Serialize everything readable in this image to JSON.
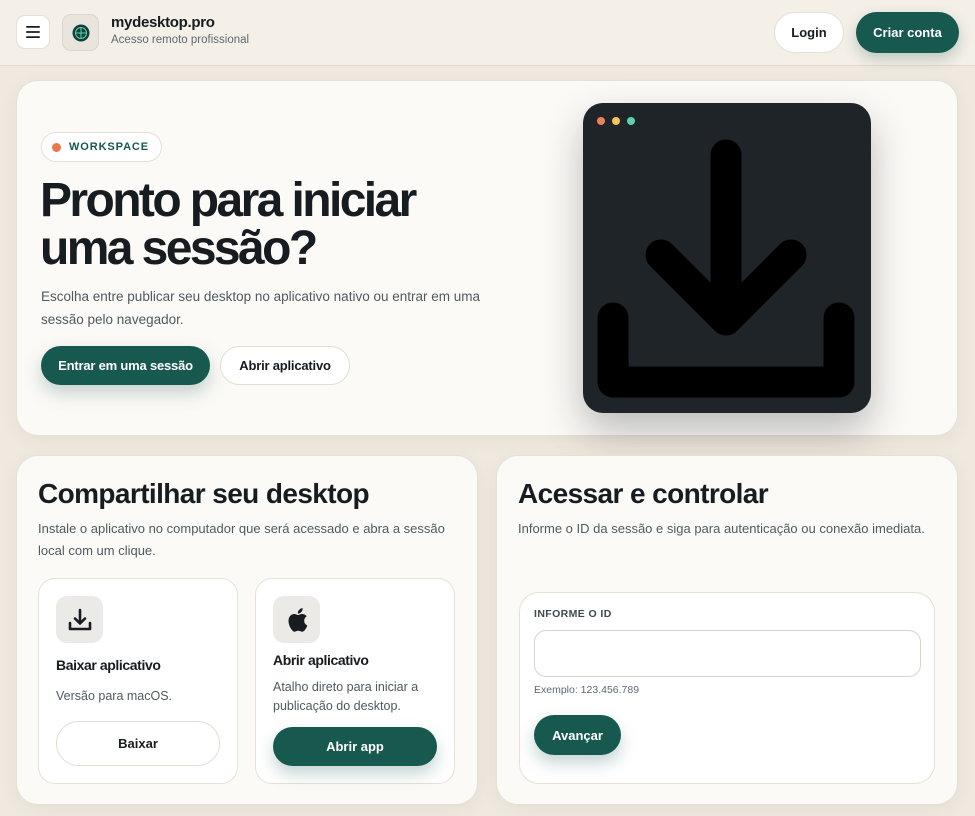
{
  "header": {
    "brand_name": "mydesktop.pro",
    "brand_subtitle": "Acesso remoto profissional",
    "login_label": "Login",
    "signup_label": "Criar conta",
    "menu_icon": "hamburger-menu-icon",
    "logo_icon": "globe-logo-icon"
  },
  "hero": {
    "badge": "WORKSPACE",
    "title_line1": "Pronto para iniciar",
    "title_line2": "uma sessão?",
    "description": "Escolha entre publicar seu desktop no aplicativo nativo ou entrar em uma sessão pelo navegador.",
    "primary_button": "Entrar em uma sessão",
    "secondary_button": "Abrir aplicativo",
    "preview_icon": "download-icon"
  },
  "share": {
    "title": "Compartilhar seu desktop",
    "description": "Instale o aplicativo no computador que será acessado e abra a sessão local com um clique.",
    "options": [
      {
        "icon": "download-icon",
        "title": "Baixar aplicativo",
        "description": "Versão para macOS.",
        "button": "Baixar"
      },
      {
        "icon": "apple-icon",
        "title": "Abrir aplicativo",
        "description": "Atalho direto para iniciar a publicação do desktop.",
        "button": "Abrir app"
      }
    ]
  },
  "access": {
    "title": "Acessar e controlar",
    "description": "Informe o ID da sessão e siga para autenticação ou conexão imediata.",
    "id_label": "INFORME O ID",
    "id_value": "",
    "id_hint": "Exemplo: 123.456.789",
    "submit_label": "Avançar"
  },
  "colors": {
    "accent": "#17594f",
    "background": "#efe9df",
    "badge_dot": "#e8774a",
    "preview_bg": "#1f2428"
  }
}
